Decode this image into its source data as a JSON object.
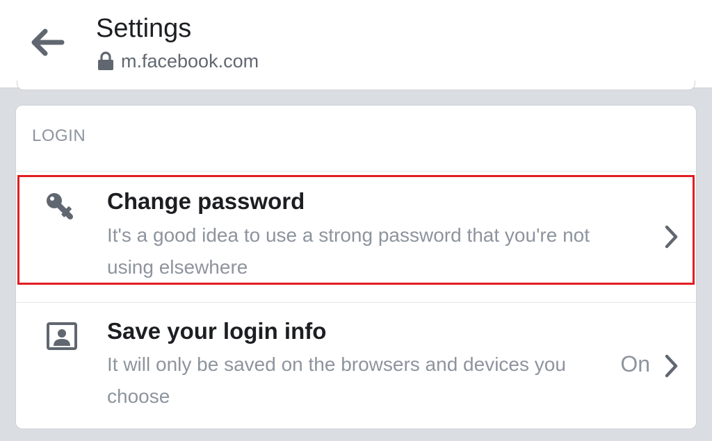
{
  "header": {
    "title": "Settings",
    "url": "m.facebook.com",
    "back_icon": "back-arrow-icon",
    "lock_icon": "lock-icon"
  },
  "section": {
    "title": "LOGIN",
    "items": [
      {
        "icon": "key-icon",
        "title": "Change password",
        "description": "It's a good idea to use a strong password that you're not using elsewhere",
        "value": "",
        "highlighted": true
      },
      {
        "icon": "contact-card-icon",
        "title": "Save your login info",
        "description": "It will only be saved on the browsers and devices you choose",
        "value": "On",
        "highlighted": false
      }
    ]
  },
  "colors": {
    "highlight_border": "#e21d22",
    "text_primary": "#1c1e21",
    "text_secondary": "#8d949e",
    "background": "#dadde2"
  }
}
